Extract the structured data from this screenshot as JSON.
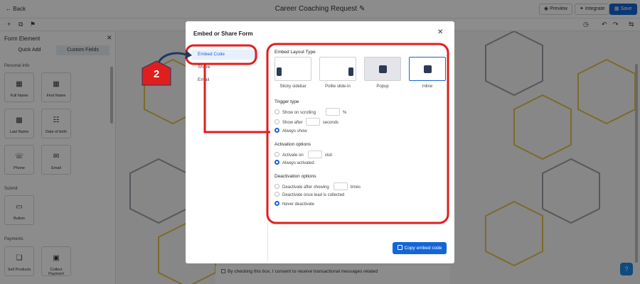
{
  "topbar": {
    "back_label": "Back",
    "doc_title": "Career Coaching Request",
    "preview_label": "Preview",
    "integrate_label": "Integrate",
    "save_label": "Save"
  },
  "left_panel": {
    "title": "Form Element",
    "tabs": [
      "Quick Add",
      "Custom Fields"
    ],
    "sections": {
      "personal_info": "Personal Info",
      "submit": "Submit",
      "payments": "Payments"
    },
    "fields": {
      "full_name": "Full Name",
      "first_name": "First Name",
      "last_name": "Last Name",
      "date_of_birth": "Date of birth",
      "phone": "Phone",
      "email": "Email",
      "button": "Button",
      "sell_products": "Sell Products",
      "collect_payment": "Collect Payment"
    }
  },
  "canvas": {
    "consent_text": "By checking this box, I consent to receive transactional messages related"
  },
  "modal": {
    "title": "Embed or Share Form",
    "nav": [
      "Embed Code",
      "Share",
      "Email"
    ],
    "embed_layout_title": "Embed Layout Type",
    "layouts": [
      "Sticky sidebar",
      "Polite slide-in",
      "Popup",
      "Inline"
    ],
    "selected_layout": "Inline",
    "trigger": {
      "title": "Trigger type",
      "on_scrolling": "Show on scrolling",
      "percent_unit": "%",
      "show_after": "Show after",
      "seconds_unit": "seconds",
      "always_show": "Always show",
      "selected": "Always show"
    },
    "activation": {
      "title": "Activation options",
      "activate_on": "Activate on",
      "visit_unit": "visit",
      "always_activated": "Always activated",
      "selected": "Always activated"
    },
    "deactivation": {
      "title": "Deactivation options",
      "after_showing": "Deactivate after showing",
      "times_unit": "times",
      "once_lead": "Deactivate once lead is collected",
      "never": "Never deactivate",
      "selected": "Never deactivate"
    },
    "copy_button_label": "Copy embed code"
  },
  "annotation": {
    "step_number": "2",
    "color": "#e01e1e"
  },
  "colors": {
    "accent": "#1565d8",
    "annotation_red": "#e01e1e",
    "hexagon_gold": "#e3c24d",
    "hexagon_grey": "#9aa0a8"
  }
}
